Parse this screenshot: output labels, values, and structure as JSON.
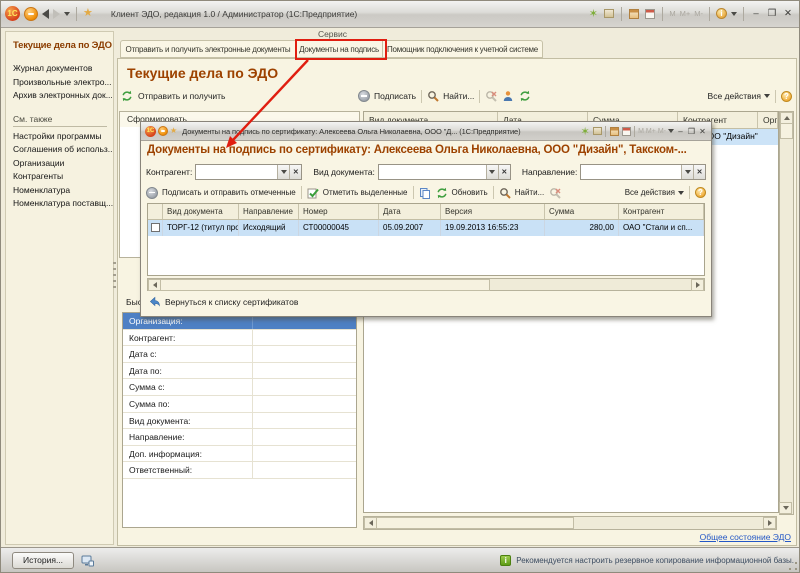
{
  "colors": {
    "annotation_red": "#E01E10",
    "header_maroon": "#9D4200",
    "selection_blue": "#4E80C4",
    "row_selection_blue": "#CCE3F7",
    "link_blue": "#2457C5"
  },
  "titlebar": {
    "title": "Клиент ЭДО, редакция 1.0 / Администратор  (1С:Предприятие)",
    "memory_labels": [
      "M",
      "M+",
      "M-"
    ],
    "btn_min": "–",
    "btn_max": "❒",
    "btn_close": "✕"
  },
  "tabs": {
    "group_label": "Сервис",
    "items": [
      "Отправить и получить электронные документы",
      "Документы на подпись",
      "Помощник подключения к учетной системе"
    ]
  },
  "sidebar": {
    "title": "Текущие дела по ЭДО",
    "items": [
      "Журнал документов",
      "Произвольные электро...",
      "Архив электронных док..."
    ],
    "see_also_label": "См. также",
    "see_also_items": [
      "Настройки программы",
      "Соглашения об использ...",
      "Организации",
      "Контрагенты",
      "Номенклатура",
      "Номенклатура поставщ..."
    ]
  },
  "main": {
    "title": "Текущие дела по ЭДО",
    "toolbar": {
      "send_receive": "Отправить и получить",
      "sign": "Подписать",
      "find": "Найти...",
      "all_actions": "Все действия"
    },
    "left_table_header": "Сформировать",
    "quick_filter_label": "Быстрый отбор",
    "table_headers": [
      "Вид документа",
      "Дата",
      "Сумма",
      "Контрагент",
      "Организация"
    ],
    "selected_row_fragment": "ООО \"Дизайн\"",
    "filter_rows": [
      "Организация:",
      "Контрагент:",
      "Дата с:",
      "Дата по:",
      "Сумма с:",
      "Сумма по:",
      "Вид документа:",
      "Направление:",
      "Доп. информация:",
      "Ответственный:"
    ],
    "footer_link": "Общее состояние ЭДО"
  },
  "dialog": {
    "title": "Документы на подпись по сертификату: Алексеева Ольга Николаевна, ООО \"Д...  (1С:Предприятие)",
    "header": "Документы на подпись по сертификату: Алексеева Ольга Николаевна, ООО \"Дизайн\", Такском-...",
    "filters": [
      "Контрагент:",
      "Вид документа:",
      "Направление:"
    ],
    "toolbar": {
      "sign_send": "Подписать и отправить отмеченные",
      "mark_selected": "Отметить выделенные",
      "refresh": "Обновить",
      "find": "Найти...",
      "all_actions": "Все действия"
    },
    "table_headers": [
      "Вид документа",
      "Направление",
      "Номер",
      "Дата",
      "Версия",
      "Сумма",
      "Контрагент"
    ],
    "rows": [
      {
        "doc_type": "ТОРГ-12 (титул прод...",
        "direction": "Исходящий",
        "number": "СТ00000045",
        "date": "05.09.2007",
        "version": "19.09.2013 16:55:23",
        "sum": "280,00",
        "contractor": "ОАО \"Стали и сп..."
      }
    ],
    "back_link": "Вернуться к списку сертификатов",
    "memory_labels": [
      "M",
      "M+",
      "M-"
    ],
    "btn_min": "–",
    "btn_max": "❒",
    "btn_close": "✕"
  },
  "statusbar": {
    "history_button": "История...",
    "message": "Рекомендуется настроить резервное копирование информационной базы."
  }
}
